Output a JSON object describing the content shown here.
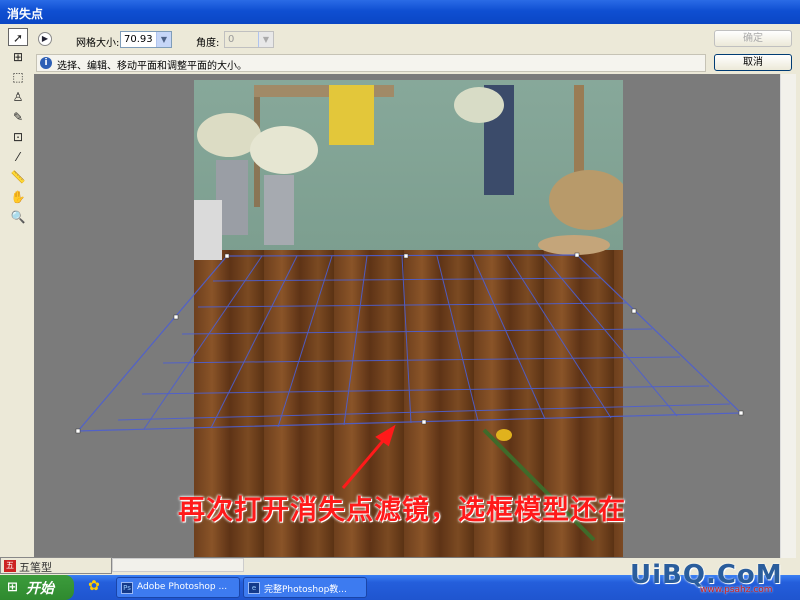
{
  "window": {
    "title": "消失点"
  },
  "options": {
    "grid_size_label": "网格大小:",
    "grid_size_value": "70.93",
    "angle_label": "角度:",
    "angle_value": "0",
    "ok_label": "确定",
    "cancel_label": "取消"
  },
  "info": {
    "text": "选择、编辑、移动平面和调整平面的大小。"
  },
  "annotation": {
    "text": "再次打开消失点滤镜，选框模型还在"
  },
  "ime": {
    "label": "五笔型"
  },
  "taskbar": {
    "start_label": "开始",
    "tasks": [
      {
        "label": "Adobe Photoshop ..."
      },
      {
        "label": "完整Photoshop教..."
      }
    ]
  },
  "watermark": {
    "text": "UiBQ.CoM",
    "sub": "www.psahz.com"
  },
  "colors": {
    "accent": "#0a46c4",
    "grid": "#4455cc",
    "callout": "#ff1a1a"
  }
}
